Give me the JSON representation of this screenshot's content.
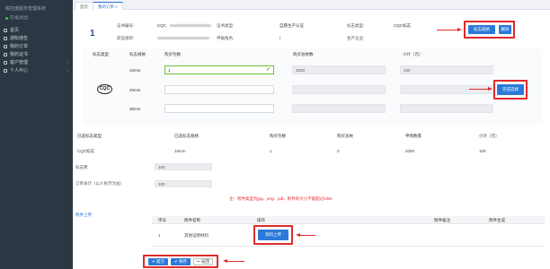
{
  "sidebar": {
    "title": "税控盘服务管理系统",
    "status": "在线[退出]",
    "items": [
      {
        "label": "首页"
      },
      {
        "label": "通知通告"
      },
      {
        "label": "我的订单"
      },
      {
        "label": "我的证书"
      },
      {
        "label": "客户管理"
      },
      {
        "label": "个人中心"
      }
    ]
  },
  "tabs": [
    {
      "label": "首页"
    },
    {
      "label": "我的订单 ×"
    }
  ],
  "header": {
    "index": "1",
    "cert_no_label": "证书编号:",
    "cert_no_value": "CQC",
    "cert_type_label": "证书类型:",
    "cert_type_value": "自愿生产认证",
    "mark_type_label": "标志类型:",
    "mark_type_value": "CQC标志",
    "org_label": "获证组织:",
    "apply_label": "申报角色:",
    "apply_value": "/",
    "producer_label": "生产企业:",
    "btn_spec": "标志规格",
    "btn_delete": "删除"
  },
  "spec_table": {
    "headers": [
      "标志类型",
      "标志规格",
      "购买包数",
      "购买总枚数",
      "小计（元）"
    ],
    "logo_text": "CQC",
    "rows": [
      {
        "size": "10mm",
        "qty": "1",
        "total": "2000",
        "subtotal": "100"
      },
      {
        "size": "20mm",
        "qty": "",
        "total": "",
        "subtotal": ""
      },
      {
        "size": "30mm",
        "qty": "",
        "total": "",
        "subtotal": ""
      }
    ],
    "confirm_button": "完成选择"
  },
  "selected_table": {
    "headers": [
      "已选标志类型",
      "已选标志规格",
      "购买包数",
      "购买总枚",
      "申购数量",
      "小计（元）"
    ],
    "row": [
      "CQC标志",
      "10mm",
      "1",
      "0",
      "2000",
      "100"
    ]
  },
  "fees": {
    "mark_fee_label": "标志费",
    "mark_fee_value": "100",
    "order_total_label": "订单总计（以人民币为准）",
    "order_total_value": "100"
  },
  "note": "注：附件类型为jpg、png、pdf，附件的大小不能超过10M",
  "attachments": {
    "tag": "附件上传",
    "headers": [
      "序号",
      "附件名称",
      "操作",
      "附件备注",
      "附件生成"
    ],
    "row": {
      "no": "1",
      "name": "其他证明材料",
      "upload": "资料上传"
    }
  },
  "footer": {
    "submit": "✔ 提交",
    "save": "✔ 保存",
    "back": "↩ 返回"
  },
  "colors": {
    "accent": "#2b7ad9",
    "annotation": "#e02a2a",
    "sidebar": "#2c3744"
  }
}
